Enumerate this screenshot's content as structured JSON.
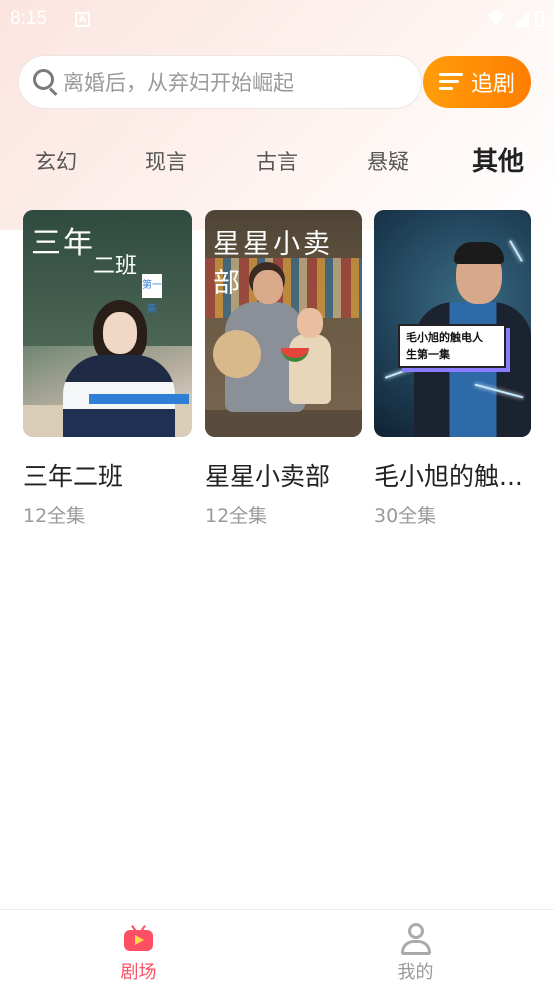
{
  "status_bar": {
    "time": "8:15",
    "notification_glyph": "A"
  },
  "search": {
    "placeholder": "离婚后，从弃妇开始崛起",
    "follow_label": "追剧"
  },
  "tabs": [
    {
      "label": "玄幻",
      "active": false
    },
    {
      "label": "现言",
      "active": false
    },
    {
      "label": "古言",
      "active": false
    },
    {
      "label": "悬疑",
      "active": false
    },
    {
      "label": "其他",
      "active": true
    }
  ],
  "dramas": [
    {
      "title": "三年二班",
      "episodes": "12全集",
      "poster_text": [
        "三年",
        "二班"
      ],
      "poster_badge": "第一集"
    },
    {
      "title": "星星小卖部",
      "episodes": "12全集",
      "poster_text": [
        "星星小卖部"
      ]
    },
    {
      "title": "毛小旭的触...",
      "episodes": "30全集",
      "poster_text": [
        "毛小旭的触电人",
        "生第一集"
      ]
    }
  ],
  "bottom_nav": [
    {
      "label": "剧场",
      "icon": "tv-icon",
      "active": true,
      "color": "#ff4f64"
    },
    {
      "label": "我的",
      "icon": "user-icon",
      "active": false,
      "color": "#9a9a9a"
    }
  ],
  "colors": {
    "accent": "#ff8a00",
    "nav_active": "#ff4f64"
  }
}
